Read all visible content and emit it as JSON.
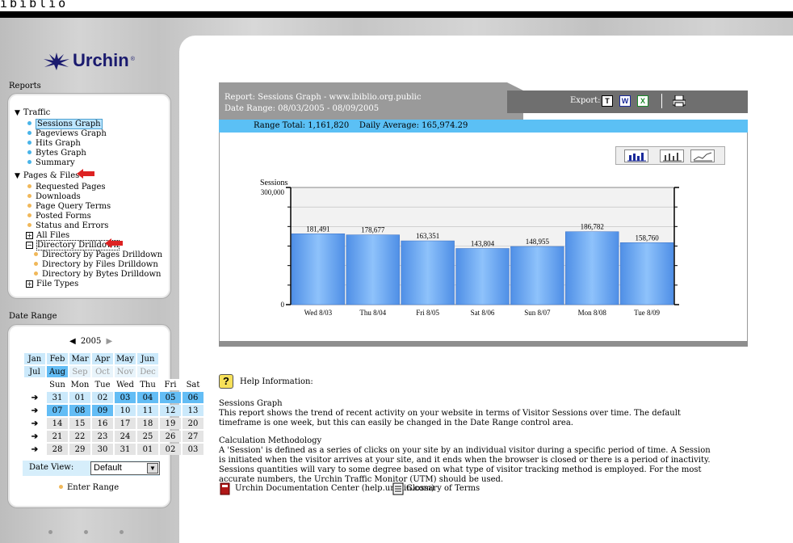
{
  "site": {
    "name": "ibiblio"
  },
  "brand": {
    "logo_text": "Urchin",
    "logo_mark": "®"
  },
  "sidebar": {
    "reports_label": "Reports",
    "tree": [
      {
        "label": "Traffic",
        "kind": "group-open"
      },
      {
        "label": "Sessions Graph",
        "kind": "leaf",
        "dot": "blue",
        "selected": true
      },
      {
        "label": "Pageviews Graph",
        "kind": "leaf",
        "dot": "blue"
      },
      {
        "label": "Hits Graph",
        "kind": "leaf",
        "dot": "blue"
      },
      {
        "label": "Bytes Graph",
        "kind": "leaf",
        "dot": "blue"
      },
      {
        "label": "Summary",
        "kind": "leaf",
        "dot": "blue"
      },
      {
        "label": "Pages & Files",
        "kind": "group-open"
      },
      {
        "label": "Requested Pages",
        "kind": "leaf",
        "dot": "orange"
      },
      {
        "label": "Downloads",
        "kind": "leaf",
        "dot": "orange"
      },
      {
        "label": "Page Query Terms",
        "kind": "leaf",
        "dot": "orange"
      },
      {
        "label": "Posted Forms",
        "kind": "leaf",
        "dot": "orange"
      },
      {
        "label": "Status and Errors",
        "kind": "leaf",
        "dot": "orange"
      },
      {
        "label": "All Files",
        "kind": "plus"
      },
      {
        "label": "Directory Drilldown",
        "kind": "minus"
      },
      {
        "label": "Directory by Pages Drilldown",
        "kind": "subleaf",
        "dot": "orange"
      },
      {
        "label": "Directory by Files Drilldown",
        "kind": "subleaf",
        "dot": "orange"
      },
      {
        "label": "Directory by Bytes Drilldown",
        "kind": "subleaf",
        "dot": "orange"
      },
      {
        "label": "File Types",
        "kind": "plus"
      }
    ],
    "date_range_label": "Date Range",
    "calendar": {
      "year": "2005",
      "months": [
        [
          "Jan",
          "Feb",
          "Mar",
          "Apr",
          "May",
          "Jun"
        ],
        [
          "Jul",
          "Aug",
          "Sep",
          "Oct",
          "Nov",
          "Dec"
        ]
      ],
      "current_month": "Aug",
      "weekdays": [
        "Sun",
        "Mon",
        "Tue",
        "Wed",
        "Thu",
        "Fri",
        "Sat"
      ],
      "weeks": [
        [
          "31",
          "01",
          "02",
          "03",
          "04",
          "05",
          "06"
        ],
        [
          "07",
          "08",
          "09",
          "10",
          "11",
          "12",
          "13"
        ],
        [
          "14",
          "15",
          "16",
          "17",
          "18",
          "19",
          "20"
        ],
        [
          "21",
          "22",
          "23",
          "24",
          "25",
          "26",
          "27"
        ],
        [
          "28",
          "29",
          "30",
          "31",
          "01",
          "02",
          "03"
        ]
      ],
      "selected_days": [
        "03",
        "04",
        "05",
        "06",
        "07",
        "08",
        "09"
      ],
      "date_view_label": "Date View:",
      "date_view_value": "Default",
      "enter_range_label": "Enter Range"
    }
  },
  "report": {
    "title_line": "Report: Sessions Graph - www.ibiblio.org.public",
    "date_range_line": "Date Range: 08/03/2005 - 08/09/2005",
    "export_label": "Export:",
    "export_buttons": [
      "T",
      "W",
      "X"
    ],
    "range_total": "Range Total: 1,161,820",
    "daily_average": "Daily Average: 165,974.29"
  },
  "chart_data": {
    "type": "bar",
    "ylabel": "Sessions",
    "ylim": [
      0,
      300000
    ],
    "y_ticks": [
      "300,000",
      "0"
    ],
    "categories": [
      "Wed 8/03",
      "Thu 8/04",
      "Fri 8/05",
      "Sat 8/06",
      "Sun 8/07",
      "Mon 8/08",
      "Tue 8/09"
    ],
    "values": [
      181491,
      178677,
      163351,
      143804,
      148955,
      186782,
      158760
    ],
    "value_labels": [
      "181,491",
      "178,677",
      "163,351",
      "143,804",
      "148,955",
      "186,782",
      "158,760"
    ],
    "bar_color": "#6aa6f0",
    "grid": true
  },
  "help": {
    "title": "Help Information:",
    "sessions_heading": "Sessions Graph",
    "sessions_text": "This report shows the trend of recent activity on your website in terms of Visitor Sessions over time. The default timeframe is one week, but this can easily be changed in the Date Range control area.",
    "calc_heading": "Calculation Methodology",
    "calc_text": "A 'Session' is defined as a series of clicks on your site by an individual visitor during a specific period of time. A Session is initiated when the visitor arrives at your site, and it ends when the browser is closed or there is a period of inactivity. Sessions quantities will vary to some degree based on what type of visitor tracking method is employed. For the most accurate numbers, the Urchin Traffic Monitor (UTM) should be used.",
    "doc_link": "Urchin Documentation Center (help.urchin.com)",
    "glossary_link": "Glossary of Terms"
  },
  "colors": {
    "accent": "#5bc0f5",
    "header_gray": "#9a9a9a",
    "header_dark": "#6f6f6f",
    "bar": "#6aa6f0"
  }
}
